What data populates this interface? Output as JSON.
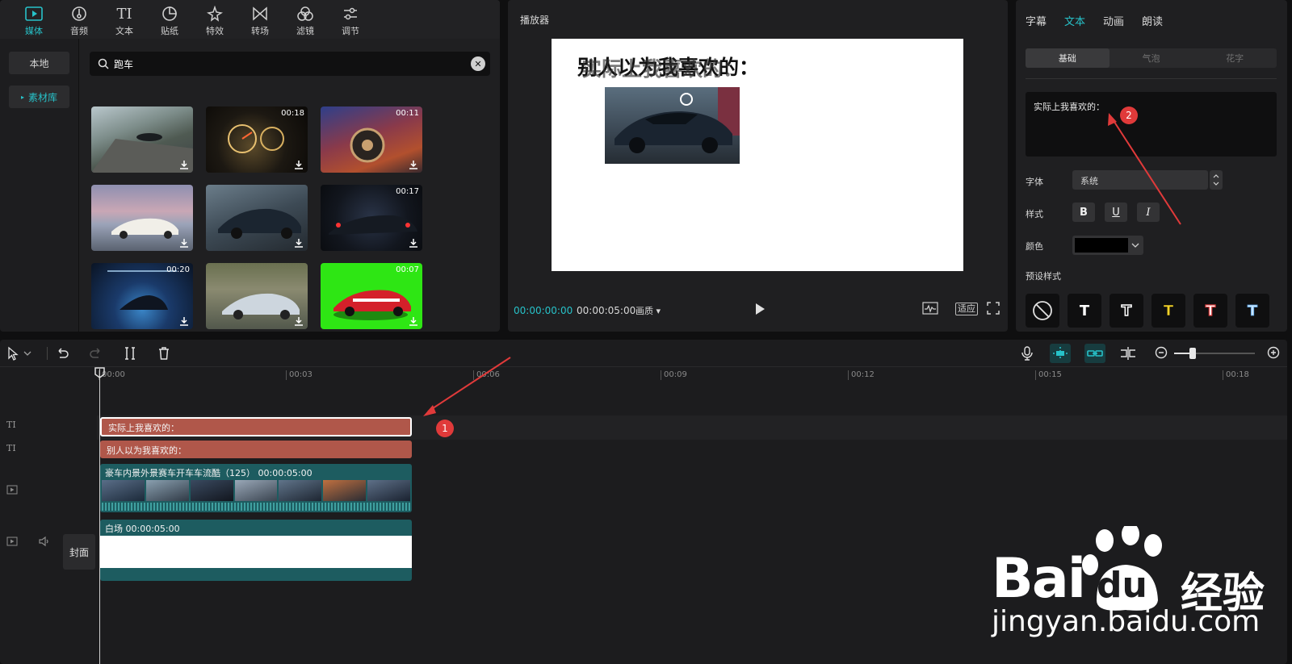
{
  "toolbar": {
    "items": [
      {
        "label": "媒体",
        "icon": "media-icon"
      },
      {
        "label": "音频",
        "icon": "audio-icon"
      },
      {
        "label": "文本",
        "icon": "text-icon"
      },
      {
        "label": "贴纸",
        "icon": "sticker-icon"
      },
      {
        "label": "特效",
        "icon": "effects-icon"
      },
      {
        "label": "转场",
        "icon": "transition-icon"
      },
      {
        "label": "滤镜",
        "icon": "filter-icon"
      },
      {
        "label": "调节",
        "icon": "adjust-icon"
      }
    ],
    "text_glyph": "TI"
  },
  "sidebar": {
    "local": "本地",
    "library": "素材库"
  },
  "search": {
    "value": "跑车",
    "clear": "✕"
  },
  "thumbs": [
    {
      "duration": ""
    },
    {
      "duration": "00:18"
    },
    {
      "duration": "00:11"
    },
    {
      "duration": ""
    },
    {
      "duration": ""
    },
    {
      "duration": "00:17"
    },
    {
      "duration": "00:20"
    },
    {
      "duration": ""
    },
    {
      "duration": "00:07"
    }
  ],
  "player": {
    "title": "播放器",
    "canvas_text_a": "别人以为我喜欢的：",
    "canvas_text_b": "实际上我喜欢的：",
    "time_current": "00:00:00:00",
    "time_total": "00:00:05:00",
    "quality": "画质 ▾",
    "fit": "适应"
  },
  "text_panel": {
    "tabs": [
      "字幕",
      "文本",
      "动画",
      "朗读"
    ],
    "subtabs": [
      "基础",
      "气泡",
      "花字"
    ],
    "content": "实际上我喜欢的：",
    "font_label": "字体",
    "font_value": "系统",
    "style_label": "样式",
    "style_bold": "B",
    "style_underline": "U",
    "style_italic": "I",
    "color_label": "颜色",
    "preset_label": "预设样式",
    "preset_glyph": "T"
  },
  "timeline": {
    "ticks": [
      "00:00",
      "00:03",
      "00:06",
      "00:09",
      "00:12",
      "00:15",
      "00:18"
    ],
    "text_track_glyph": "TI",
    "clip1": "实际上我喜欢的：",
    "clip2": "别人以为我喜欢的：",
    "video_clip": "豪车内景外景赛车开车车流酷（125）  00:00:05:00",
    "main_clip": "白场    00:00:05:00",
    "cover": "封面"
  },
  "annotations": {
    "badge1": "1",
    "badge2": "2"
  },
  "watermark": {
    "brand_a": "Bai",
    "brand_b": "du",
    "brand_c": "经验",
    "url": "jingyan.baidu.com"
  },
  "colors": {
    "accent": "#27c2c9",
    "text_clip": "#b0574a",
    "video_clip": "#1d5c60",
    "badge": "#e03a3a"
  }
}
